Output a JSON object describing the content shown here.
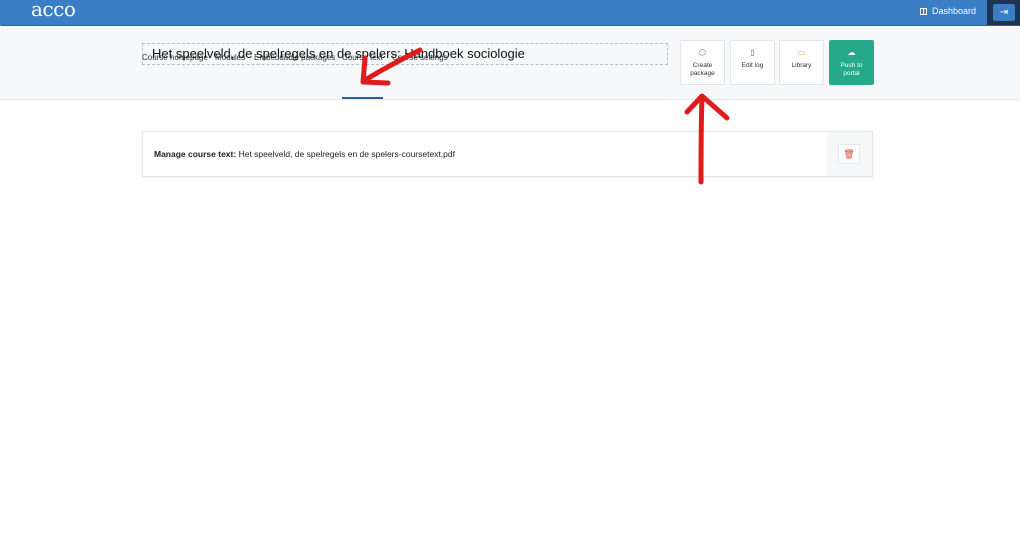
{
  "brand": {
    "logo": "acco"
  },
  "topbar": {
    "dashboard_label": "Dashboard",
    "logout_icon": "logout-icon"
  },
  "course": {
    "title": "Het speelveld, de spelregels en de spelers: Handboek sociologie"
  },
  "tabs": [
    {
      "label": "Course homepage"
    },
    {
      "label": "Modules"
    },
    {
      "label": "Embeddable packages"
    },
    {
      "label": "Course text",
      "active": true
    },
    {
      "label": "Course settings"
    }
  ],
  "actions": {
    "create_package": "Create package",
    "edit_log": "Edit log",
    "library": "Library",
    "push_to_portal": "Push to portal"
  },
  "manage": {
    "label": "Manage course text:",
    "filename": "Het speelveld, de spelregels en de spelers-coursetext.pdf"
  },
  "colors": {
    "brand_blue": "#3a7ec6",
    "push_green": "#26a98a",
    "annotation_red": "#e01b1b",
    "delete_red": "#e0443a"
  }
}
